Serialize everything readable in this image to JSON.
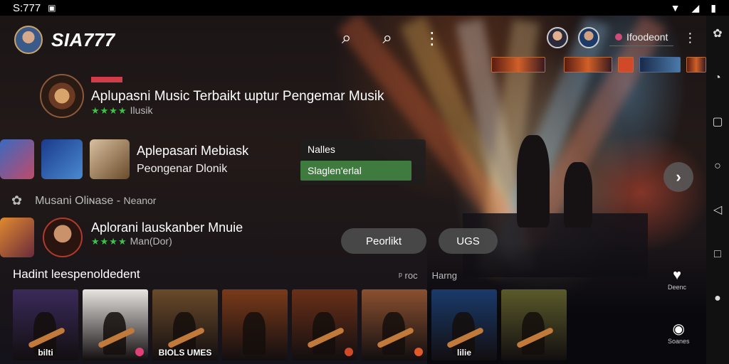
{
  "status_bar": {
    "time": "S:777",
    "battery_icon": "battery-icon",
    "wifi_icon": "wifi-icon",
    "signal_icon": "signal-icon"
  },
  "header": {
    "brand": "SIA777",
    "search_icon": "search-icon",
    "search_icon_2": "search-icon",
    "more_icon": "more-vertical-icon",
    "account_label": "Ifoodeont",
    "more_icon_2": "more-vertical-icon"
  },
  "featured": {
    "title": "Aplupasni Music Terbaikt ɯptur  Pengemar Musik",
    "rating_label": "Ilusik"
  },
  "row1": {
    "title": "Aplepasari Mebiask",
    "subtitle": "Peongenar Dlonik"
  },
  "sort_panel": {
    "label": "Nalles",
    "selected": "Slaglen'erlal"
  },
  "section": {
    "icon": "gear-icon",
    "label": "Musani Oliɴase -",
    "suffix": "Neanor"
  },
  "row2": {
    "title": "Aplorani lauskanber Mnuie",
    "rating_label": "Man(Dor)"
  },
  "pills": [
    "Peorlikt",
    "UGS"
  ],
  "next_icon": "chevron-right-icon",
  "side_actions": [
    {
      "icon": "heart-icon",
      "label": "Deenc"
    },
    {
      "icon": "share-icon",
      "label": "Soanes"
    }
  ],
  "list": {
    "heading": "Hadint leespenoldedent",
    "tool_1": "ᵖ roc",
    "tool_2": "Harng",
    "cards": [
      {
        "caption": "bilti",
        "bg": "#3a2a5a"
      },
      {
        "caption": "",
        "bg": "#e8e4e0"
      },
      {
        "caption": "BIOLS UMES",
        "bg": "#6a4a2a"
      },
      {
        "caption": "",
        "bg": "#7a3a1a"
      },
      {
        "caption": "",
        "bg": "#6a3018"
      },
      {
        "caption": "",
        "bg": "#8a5030"
      },
      {
        "caption": "lilie",
        "bg": "#1a3a6a"
      },
      {
        "caption": "",
        "bg": "#5a5a2a"
      }
    ]
  },
  "colors": {
    "accent_green": "#3cc24a",
    "accent_red": "#d23c4a",
    "panel_green": "#3f7a3f"
  }
}
